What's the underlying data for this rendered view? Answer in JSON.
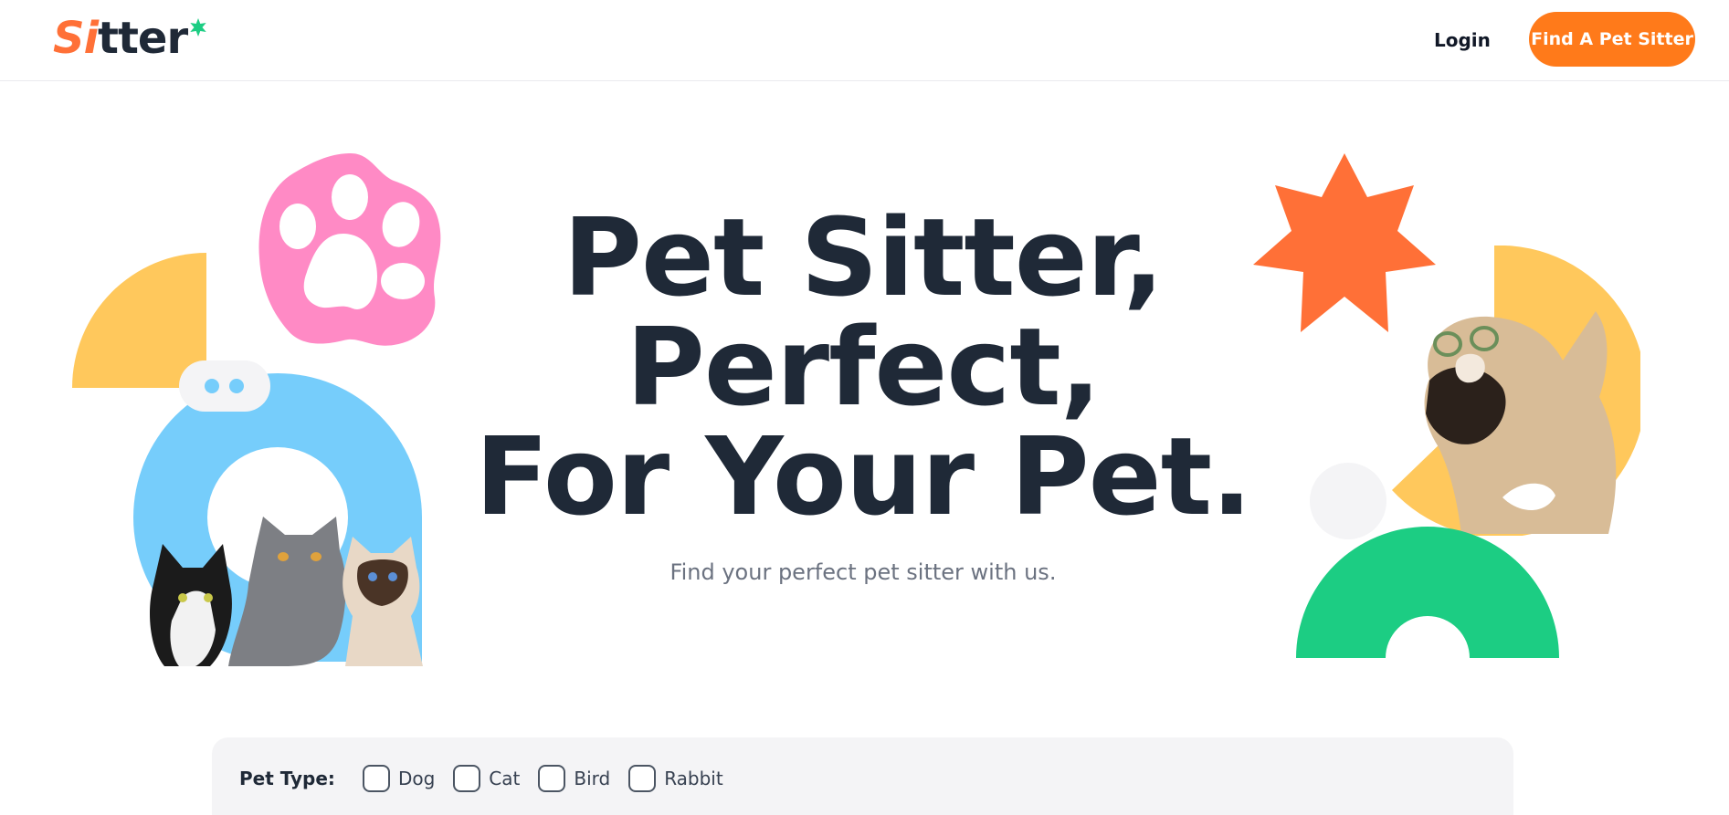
{
  "header": {
    "logo": {
      "accent": "Si",
      "rest": "tter",
      "icon": "sparkle-star-icon"
    },
    "login_label": "Login",
    "cta_label": "Find A Pet Sitter"
  },
  "hero": {
    "title_lines": [
      "Pet Sitter,",
      "Perfect,",
      "For Your Pet."
    ],
    "subtitle": "Find your perfect pet sitter with us."
  },
  "filters": {
    "label": "Pet Type:",
    "options": [
      {
        "label": "Dog",
        "checked": false
      },
      {
        "label": "Cat",
        "checked": false
      },
      {
        "label": "Bird",
        "checked": false
      },
      {
        "label": "Rabbit",
        "checked": false
      }
    ]
  },
  "colors": {
    "brand_orange": "#ff7a1a",
    "title_dark": "#1f2937",
    "pink": "#ff8ac5",
    "yellow": "#ffc85c",
    "sky_blue": "#76cdfb",
    "green": "#1ccd83",
    "star_orange": "#ff7037"
  }
}
